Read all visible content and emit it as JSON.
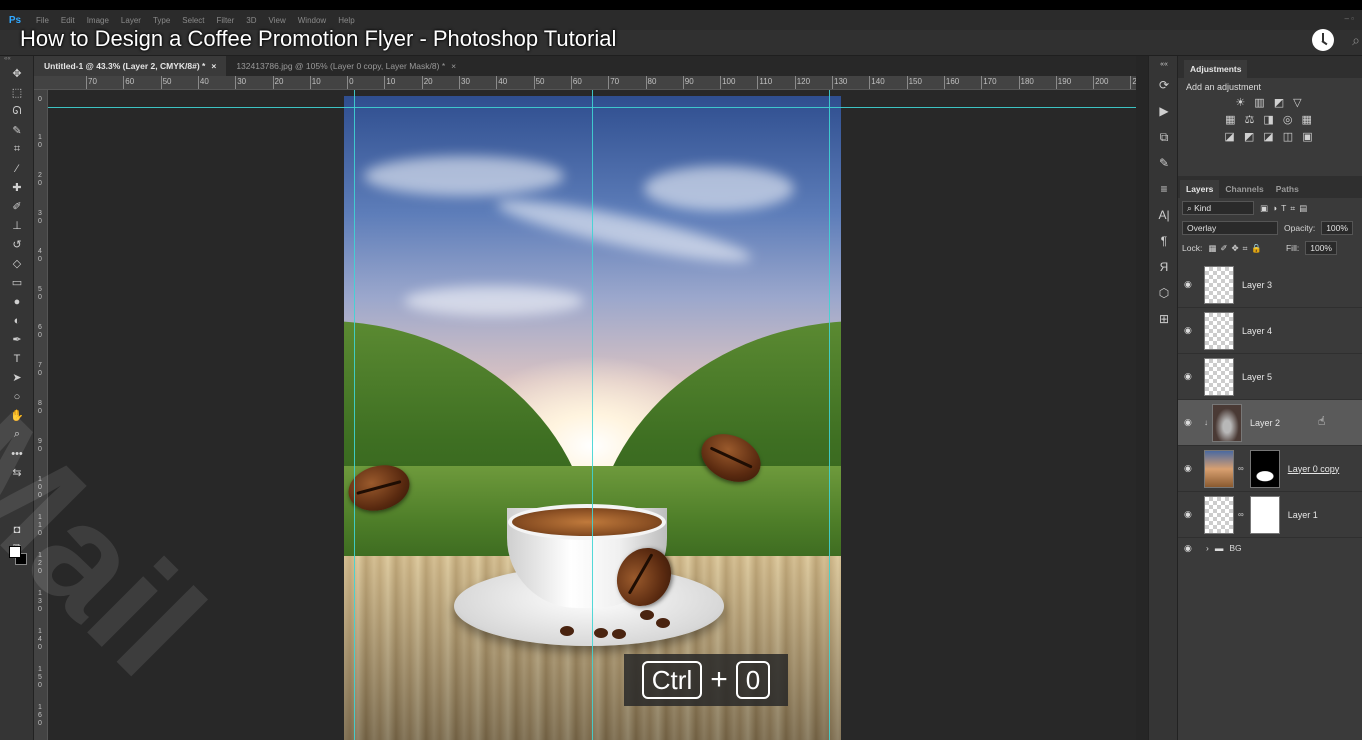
{
  "menubar": {
    "items": [
      "File",
      "Edit",
      "Image",
      "Layer",
      "Type",
      "Select",
      "Filter",
      "3D",
      "View",
      "Window",
      "Help"
    ]
  },
  "video_title": "How to Design a Coffee Promotion Flyer - Photoshop Tutorial",
  "tabs": [
    {
      "label": "Untitled-1 @ 43.3% (Layer 2, CMYK/8#) *",
      "close": "×"
    },
    {
      "label": "132413786.jpg @ 105% (Layer 0 copy, Layer Mask/8) *",
      "close": "×"
    }
  ],
  "ruler_top": [
    "70",
    "60",
    "50",
    "40",
    "30",
    "20",
    "10",
    "0",
    "10",
    "20",
    "30",
    "40",
    "50",
    "60",
    "70",
    "80",
    "90",
    "100",
    "110",
    "120",
    "130",
    "140",
    "150",
    "160",
    "170",
    "180",
    "190",
    "200",
    "2"
  ],
  "ruler_left": [
    "0",
    "1 0",
    "2 0",
    "3 0",
    "4 0",
    "5 0",
    "6 0",
    "7 0",
    "8 0",
    "9 0",
    "1 0 0",
    "1 1 0",
    "1 2 0",
    "1 3 0",
    "1 4 0",
    "1 5 0",
    "1 6 0"
  ],
  "keystroke": {
    "key1": "Ctrl",
    "plus": "+",
    "key2": "0"
  },
  "adjustments": {
    "tab": "Adjustments",
    "subtitle": "Add an adjustment",
    "row1": "☀ ▥ ◩ ▽",
    "row2": "▦ ⚖ ◨ ◎ ▦",
    "row3": "◪ ◩ ◪ ◫ ▣"
  },
  "layers_panel": {
    "tabs": [
      "Layers",
      "Channels",
      "Paths"
    ],
    "kind_label": "Kind",
    "blend_mode": "Overlay",
    "opacity_label": "Opacity:",
    "opacity_value": "100%",
    "lock_label": "Lock:",
    "fill_label": "Fill:",
    "fill_value": "100%",
    "layers": [
      {
        "name": "Layer 3"
      },
      {
        "name": "Layer 4"
      },
      {
        "name": "Layer 5"
      },
      {
        "name": "Layer 2"
      },
      {
        "name": "Layer 0 copy"
      },
      {
        "name": "Layer 1"
      }
    ],
    "group_name": "BG"
  },
  "watermark": "Mail"
}
